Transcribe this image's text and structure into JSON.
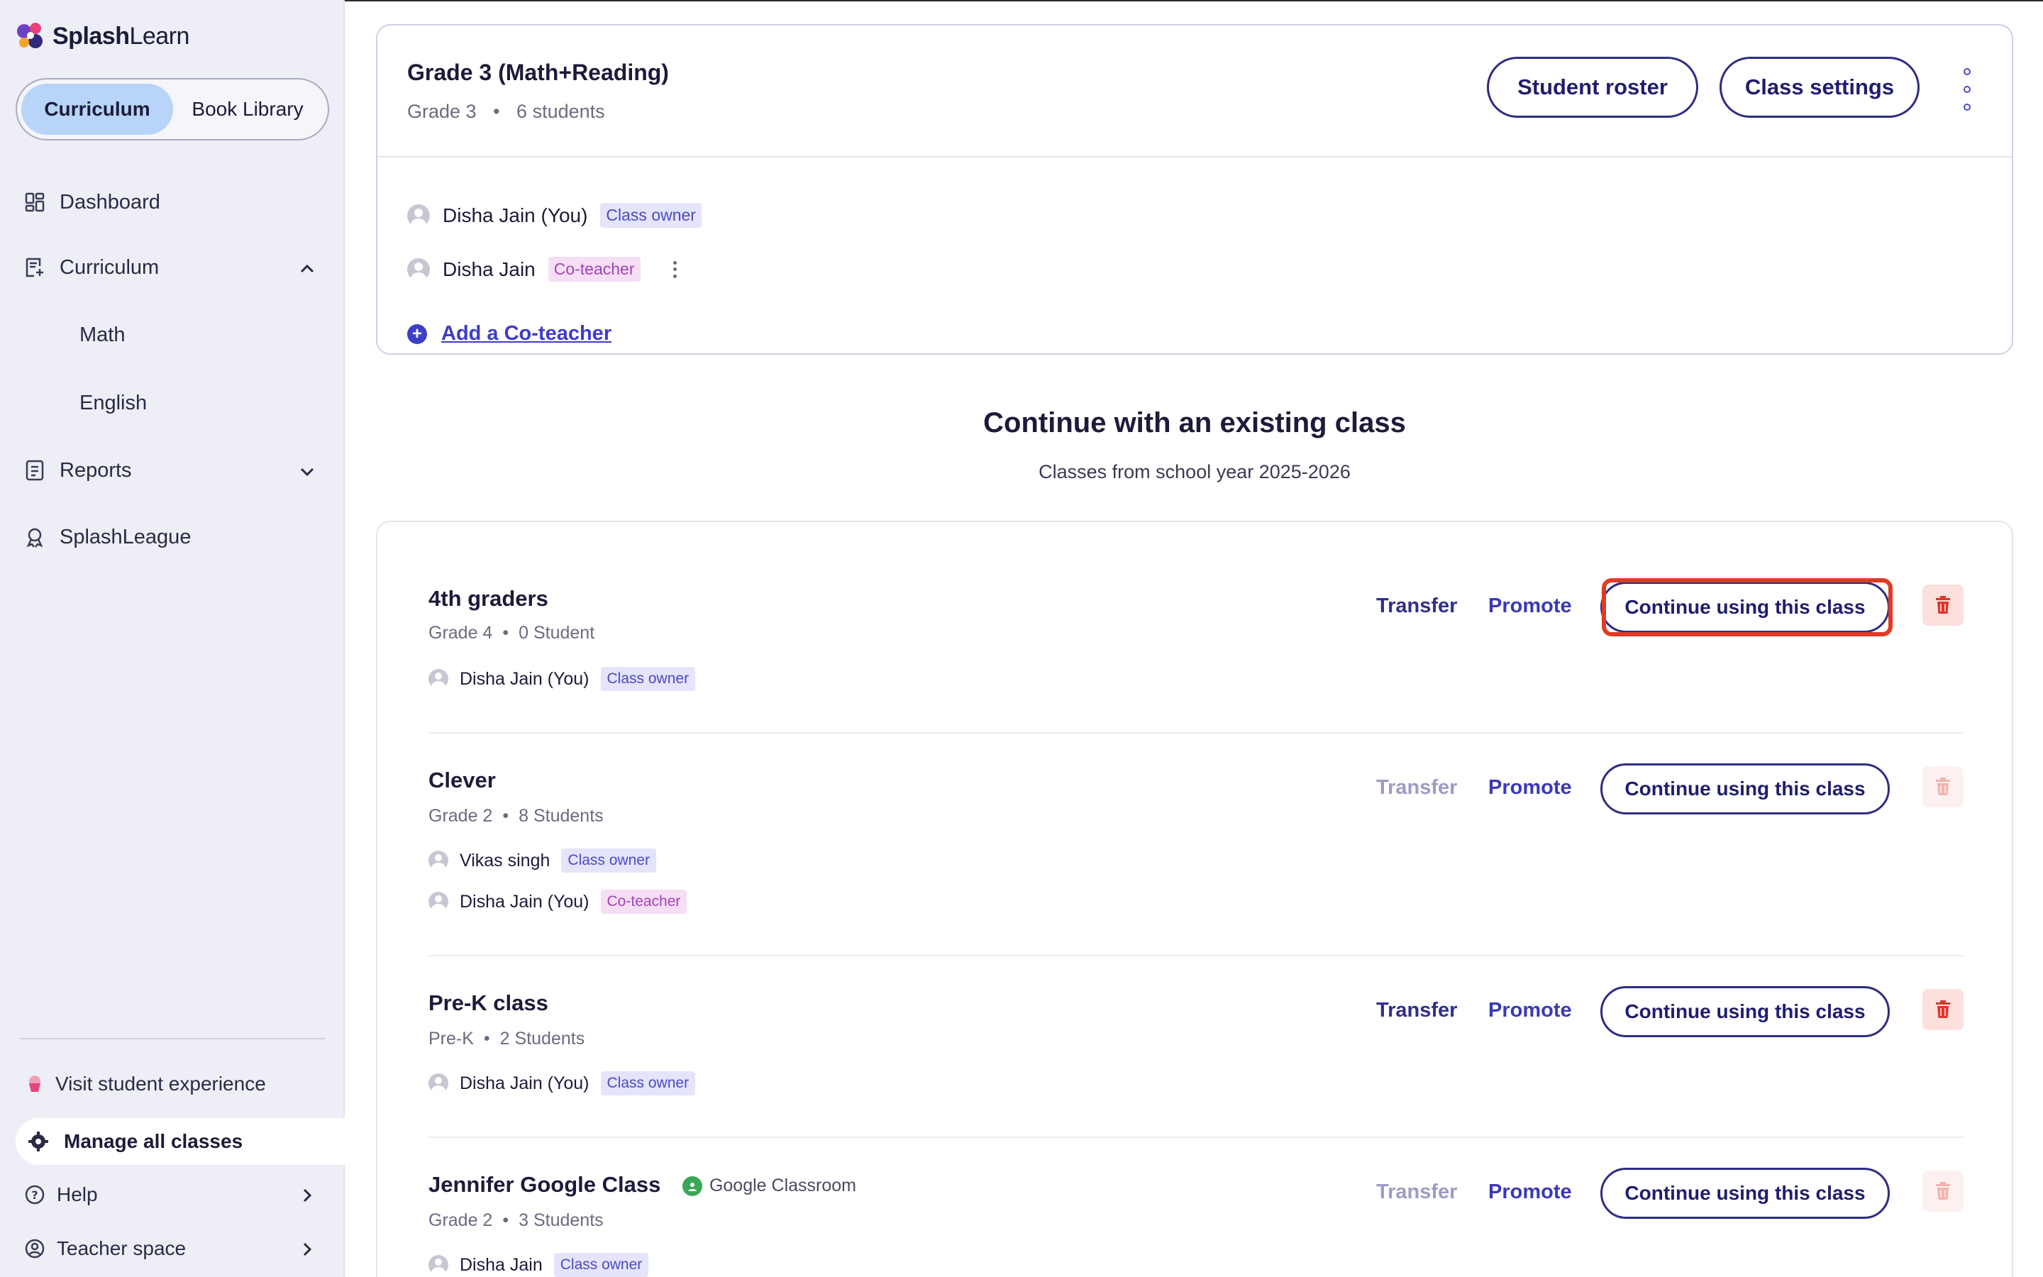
{
  "app": {
    "brand_bold": "Splash",
    "brand_light": "Learn"
  },
  "sidebar": {
    "segments": [
      {
        "label": "Curriculum",
        "active": true
      },
      {
        "label": "Book Library",
        "active": false
      }
    ],
    "nav": [
      {
        "label": "Dashboard",
        "icon": "dashboard-icon"
      },
      {
        "label": "Curriculum",
        "icon": "curriculum-icon",
        "expanded": true
      },
      {
        "label": "Math"
      },
      {
        "label": "English"
      },
      {
        "label": "Reports",
        "icon": "reports-icon",
        "expanded": false
      },
      {
        "label": "SplashLeague",
        "icon": "league-icon"
      }
    ],
    "visit_student": "Visit student experience",
    "manage_classes": "Manage all classes",
    "help": "Help",
    "teacher_space": "Teacher space"
  },
  "current_class": {
    "title": "Grade 3 (Math+Reading)",
    "grade": "Grade 3",
    "bullet": "•",
    "students": "6 students",
    "student_roster_btn": "Student roster",
    "class_settings_btn": "Class settings",
    "teachers": [
      {
        "name": "Disha Jain (You)",
        "role": "Class owner"
      },
      {
        "name": "Disha Jain",
        "role": "Co-teacher"
      }
    ],
    "add_coteacher": "Add a Co-teacher"
  },
  "existing": {
    "title": "Continue with an existing class",
    "subtitle": "Classes from school year 2025-2026",
    "transfer_label": "Transfer",
    "promote_label": "Promote",
    "continue_label": "Continue using this class",
    "classes": [
      {
        "name": "4th graders",
        "grade": "Grade 4",
        "students": "0 Student",
        "transfer_enabled": true,
        "delete_enabled": true,
        "highlighted": true,
        "teachers": [
          {
            "name": "Disha Jain (You)",
            "role": "Class owner"
          }
        ]
      },
      {
        "name": "Clever",
        "grade": "Grade 2",
        "students": "8 Students",
        "transfer_enabled": false,
        "delete_enabled": false,
        "teachers": [
          {
            "name": "Vikas singh",
            "role": "Class owner"
          },
          {
            "name": "Disha Jain (You)",
            "role": "Co-teacher"
          }
        ]
      },
      {
        "name": "Pre-K class",
        "grade": "Pre-K",
        "students": "2 Students",
        "transfer_enabled": true,
        "delete_enabled": true,
        "teachers": [
          {
            "name": "Disha Jain (You)",
            "role": "Class owner"
          }
        ]
      },
      {
        "name": "Jennifer Google Class",
        "source": "Google Classroom",
        "grade": "Grade 2",
        "students": "3 Students",
        "transfer_enabled": false,
        "delete_enabled": false,
        "teachers": [
          {
            "name": "Disha Jain",
            "role": "Class owner"
          }
        ]
      }
    ]
  },
  "colors": {
    "accent": "#2e2d85",
    "highlight": "#e23a22",
    "owner_badge_bg": "#e4e4fb",
    "coteacher_badge_bg": "#f6def5",
    "active_segment": "#b8d4f9"
  }
}
